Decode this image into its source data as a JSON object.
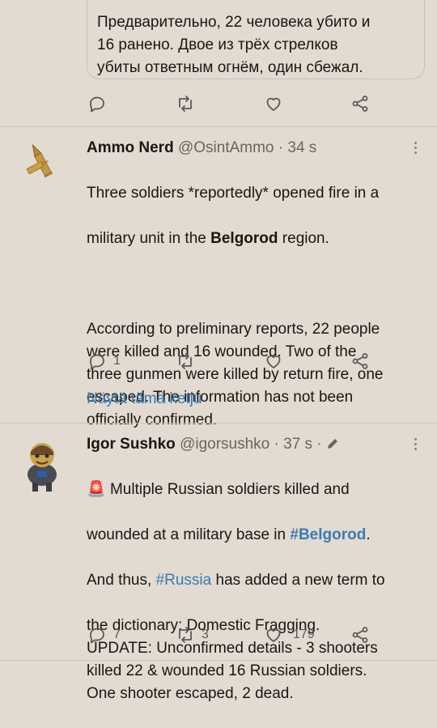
{
  "quoted": {
    "text": "Предварительно, 22 человека убито и\n16 ранено. Двое из трёх стрелков\nубиты ответным огнём, один сбежал."
  },
  "tweets": [
    {
      "author": "Ammo Nerd",
      "handle": "@OsintAmmo",
      "separator": "·",
      "time": "34 s",
      "line1_a": "Three soldiers *reportedly* opened fire in a",
      "line2_a": "military unit in the ",
      "line2_bold": "Belgorod",
      "line2_b": " region.",
      "paragraph2": "According to preliminary reports, 22 people\nwere killed and 16 wounded. Two of the\nthree gunmen were killed by return fire, one\nescaped. The information has not been\nofficially confirmed.",
      "replies": "1",
      "show_thread": "Näytä tämä ketju"
    },
    {
      "author": "Igor Sushko",
      "handle": "@igorsushko",
      "separator": "·",
      "time": "37 s",
      "emoji": "🚨",
      "line1": " Multiple Russian soldiers killed and",
      "line2_a": "wounded at a military base in ",
      "line2_link": "#Belgorod",
      "line2_b": ".",
      "line3_a": "And thus, ",
      "line3_link": "#Russia",
      "line3_b": " has added a new term to",
      "rest": "the dictionary: Domestic Fragging.\nUPDATE: Unconfirmed details - 3 shooters\nkilled 22 & wounded 16 Russian soldiers.\nOne shooter escaped, 2 dead.",
      "replies": "7",
      "retweets": "3",
      "likes": "179"
    }
  ],
  "colors": {
    "background": "#e3dad2",
    "link": "#3a7bb3",
    "text": "#1b1612",
    "muted": "#6b645e"
  }
}
